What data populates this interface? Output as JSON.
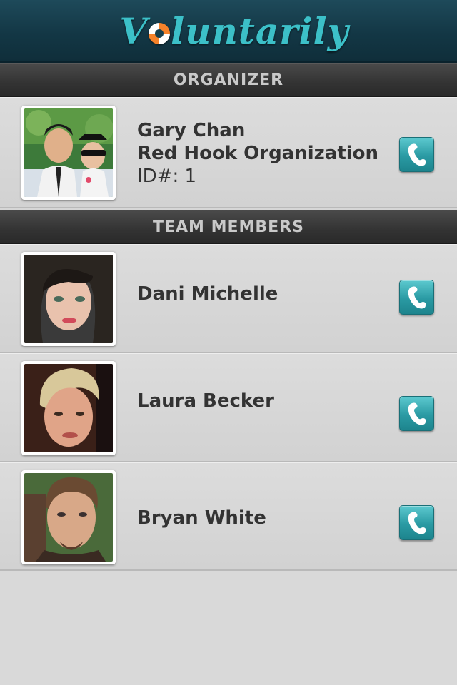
{
  "app": {
    "title": "Voluntarily",
    "title_before_ring": "V",
    "title_after_ring": "luntarily"
  },
  "sections": {
    "organizer_header": "ORGANIZER",
    "team_header": "TEAM MEMBERS"
  },
  "organizer": {
    "name": "Gary Chan",
    "organization": "Red Hook Organization",
    "id_text": "ID#: 1",
    "call_icon": "phone-icon"
  },
  "team_members": [
    {
      "name": "Dani Michelle",
      "call_icon": "phone-icon"
    },
    {
      "name": "Laura Becker",
      "call_icon": "phone-icon"
    },
    {
      "name": "Bryan White",
      "call_icon": "phone-icon"
    }
  ],
  "colors": {
    "accent": "#2a9aa3",
    "header_bg": "#133745",
    "logo": "#3cc0c8",
    "ring_orange": "#f5822a"
  }
}
